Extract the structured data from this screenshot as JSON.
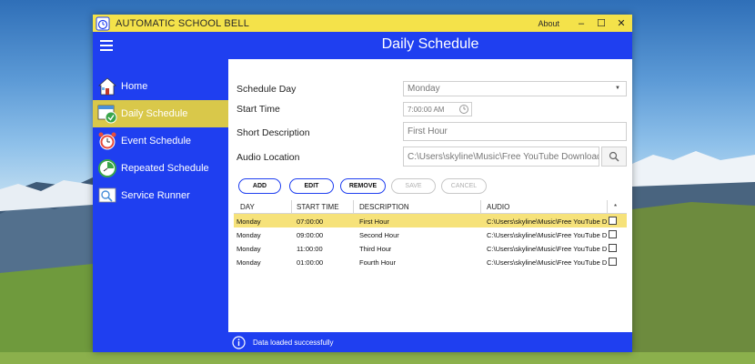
{
  "window": {
    "title": "AUTOMATIC SCHOOL BELL",
    "about_label": "About",
    "minimize_label": "–",
    "maximize_label": "☐",
    "close_label": "✕"
  },
  "header": {
    "title": "Daily Schedule"
  },
  "sidebar": {
    "items": [
      {
        "label": "Home",
        "icon": "home-icon"
      },
      {
        "label": "Daily Schedule",
        "icon": "calendar-clock-icon",
        "active": true
      },
      {
        "label": "Event Schedule",
        "icon": "alarm-clock-icon"
      },
      {
        "label": "Repeated Schedule",
        "icon": "repeat-clock-icon"
      },
      {
        "label": "Service Runner",
        "icon": "service-runner-icon"
      }
    ]
  },
  "form": {
    "schedule_day_label": "Schedule Day",
    "schedule_day_value": "Monday",
    "start_time_label": "Start Time",
    "start_time_value": "7:00:00 AM",
    "short_description_label": "Short Description",
    "short_description_value": "First Hour",
    "audio_location_label": "Audio Location",
    "audio_location_value": "C:\\Users\\skyline\\Music\\Free YouTube Downloader\\MONA L - SURAT C"
  },
  "actions": {
    "add": "ADD",
    "edit": "EDIT",
    "remove": "REMOVE",
    "save": "SAVE",
    "cancel": "CANCEL"
  },
  "table": {
    "columns": [
      "DAY",
      "START TIME",
      "DESCRIPTION",
      "AUDIO",
      "*"
    ],
    "rows": [
      {
        "day": "Monday",
        "start": "07:00:00",
        "desc": "First Hour",
        "audio": "C:\\Users\\skyline\\Music\\Free YouTube Dov"
      },
      {
        "day": "Monday",
        "start": "09:00:00",
        "desc": "Second Hour",
        "audio": "C:\\Users\\skyline\\Music\\Free YouTube Dov"
      },
      {
        "day": "Monday",
        "start": "11:00:00",
        "desc": "Third Hour",
        "audio": "C:\\Users\\skyline\\Music\\Free YouTube Dov"
      },
      {
        "day": "Monday",
        "start": "01:00:00",
        "desc": "Fourth Hour",
        "audio": "C:\\Users\\skyline\\Music\\Free YouTube Dov"
      }
    ],
    "selected_row": 0
  },
  "status": {
    "message": "Data loaded successfully",
    "icon": "info-icon"
  },
  "colors": {
    "accent_blue": "#1f3ff0",
    "title_yellow": "#f4e24a",
    "active_yellow": "#d9c84a",
    "selected_row": "#f6e27a"
  }
}
